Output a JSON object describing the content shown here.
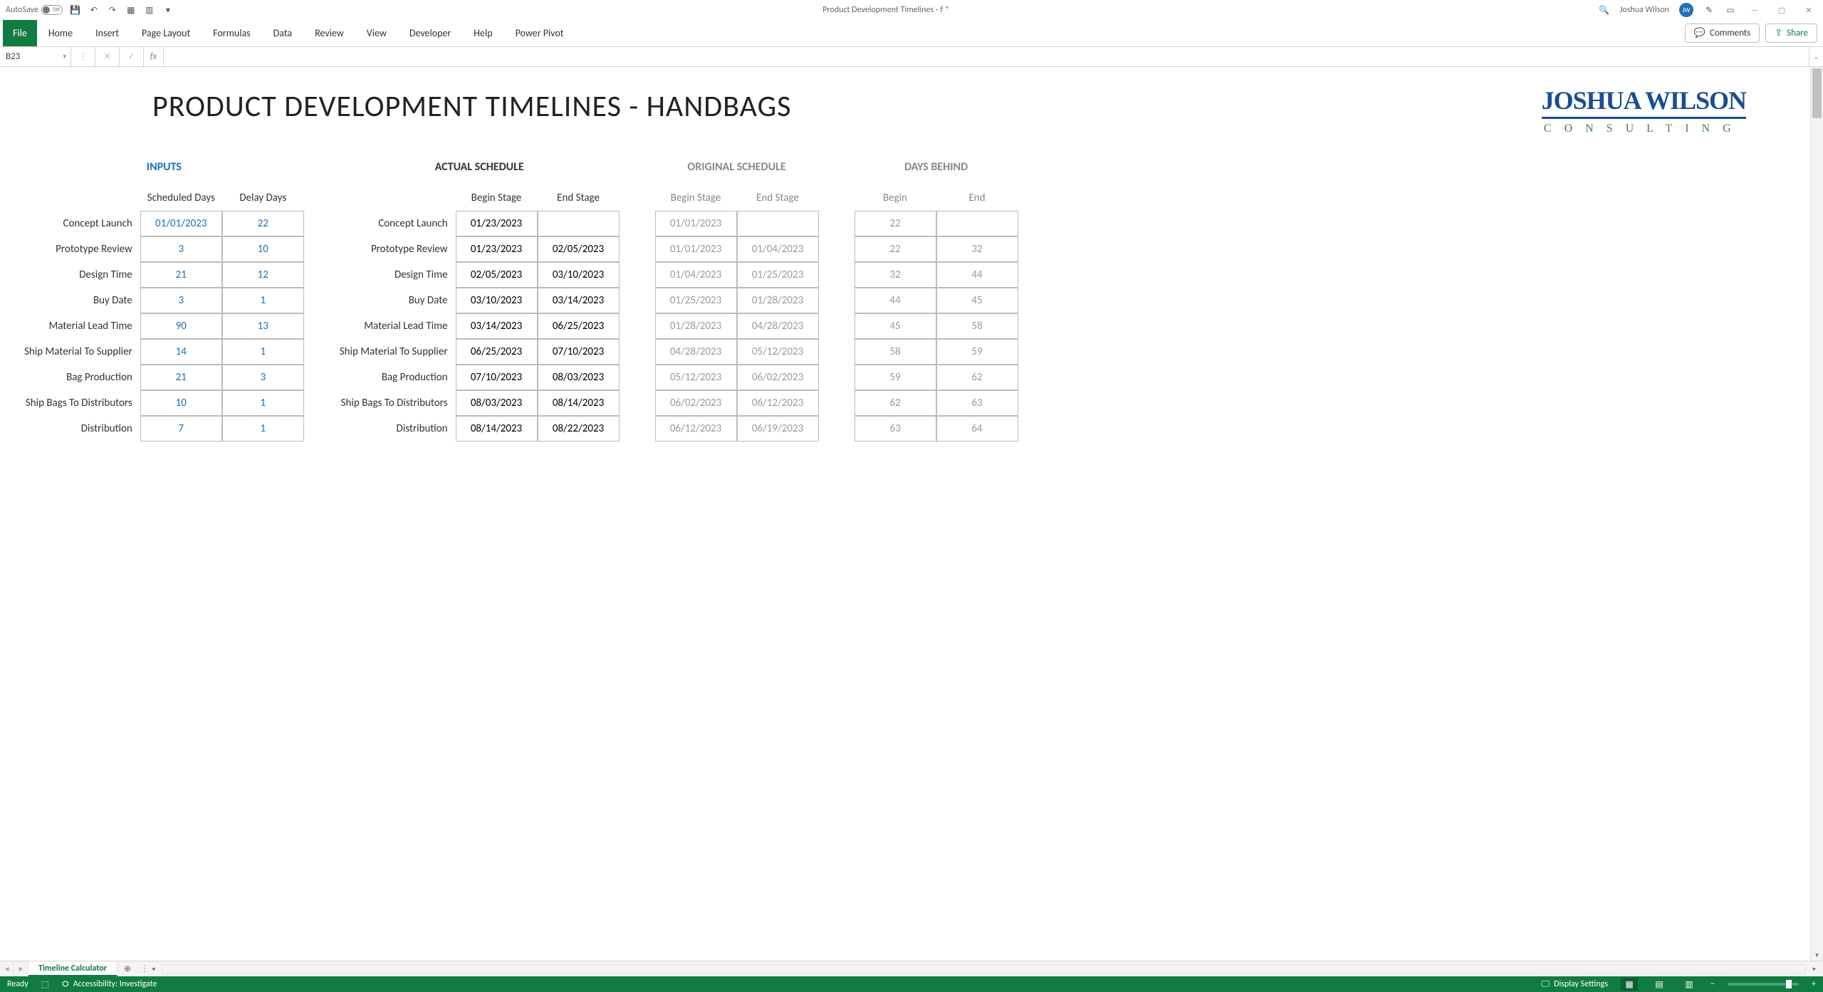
{
  "titlebar": {
    "autosave_label": "AutoSave",
    "autosave_state": "Off",
    "doc_title": "Product Development Timelines - f",
    "username": "Joshua Wilson",
    "avatar_initials": "JW"
  },
  "ribbon": {
    "tabs": [
      "File",
      "Home",
      "Insert",
      "Page Layout",
      "Formulas",
      "Data",
      "Review",
      "View",
      "Developer",
      "Help",
      "Power Pivot"
    ],
    "comments": "Comments",
    "share": "Share"
  },
  "formula_bar": {
    "name_box": "B23",
    "formula": ""
  },
  "document": {
    "title": "PRODUCT DEVELOPMENT TIMELINES - HANDBAGS",
    "logo_main": "JOSHUA WILSON",
    "logo_sub": "CONSULTING"
  },
  "row_labels": [
    "Concept Launch",
    "Prototype Review",
    "Design Time",
    "Buy Date",
    "Material Lead Time",
    "Ship Material To Supplier",
    "Bag Production",
    "Ship Bags To Distributors",
    "Distribution"
  ],
  "sections": {
    "inputs": {
      "title": "INPUTS",
      "cols": [
        "Scheduled Days",
        "Delay Days"
      ],
      "data": [
        [
          "01/01/2023",
          "22"
        ],
        [
          "3",
          "10"
        ],
        [
          "21",
          "12"
        ],
        [
          "3",
          "1"
        ],
        [
          "90",
          "13"
        ],
        [
          "14",
          "1"
        ],
        [
          "21",
          "3"
        ],
        [
          "10",
          "1"
        ],
        [
          "7",
          "1"
        ]
      ]
    },
    "actual": {
      "title": "ACTUAL SCHEDULE",
      "cols": [
        "Begin Stage",
        "End Stage"
      ],
      "data": [
        [
          "01/23/2023",
          ""
        ],
        [
          "01/23/2023",
          "02/05/2023"
        ],
        [
          "02/05/2023",
          "03/10/2023"
        ],
        [
          "03/10/2023",
          "03/14/2023"
        ],
        [
          "03/14/2023",
          "06/25/2023"
        ],
        [
          "06/25/2023",
          "07/10/2023"
        ],
        [
          "07/10/2023",
          "08/03/2023"
        ],
        [
          "08/03/2023",
          "08/14/2023"
        ],
        [
          "08/14/2023",
          "08/22/2023"
        ]
      ]
    },
    "original": {
      "title": "ORIGINAL SCHEDULE",
      "cols": [
        "Begin Stage",
        "End Stage"
      ],
      "data": [
        [
          "01/01/2023",
          ""
        ],
        [
          "01/01/2023",
          "01/04/2023"
        ],
        [
          "01/04/2023",
          "01/25/2023"
        ],
        [
          "01/25/2023",
          "01/28/2023"
        ],
        [
          "01/28/2023",
          "04/28/2023"
        ],
        [
          "04/28/2023",
          "05/12/2023"
        ],
        [
          "05/12/2023",
          "06/02/2023"
        ],
        [
          "06/02/2023",
          "06/12/2023"
        ],
        [
          "06/12/2023",
          "06/19/2023"
        ]
      ]
    },
    "days": {
      "title": "DAYS BEHIND",
      "cols": [
        "Begin",
        "End"
      ],
      "data": [
        [
          "22",
          ""
        ],
        [
          "22",
          "32"
        ],
        [
          "32",
          "44"
        ],
        [
          "44",
          "45"
        ],
        [
          "45",
          "58"
        ],
        [
          "58",
          "59"
        ],
        [
          "59",
          "62"
        ],
        [
          "62",
          "63"
        ],
        [
          "63",
          "64"
        ]
      ]
    }
  },
  "sheet_tabs": {
    "active": "Timeline Calculator"
  },
  "statusbar": {
    "ready": "Ready",
    "accessibility": "Accessibility: Investigate",
    "display_settings": "Display Settings"
  }
}
